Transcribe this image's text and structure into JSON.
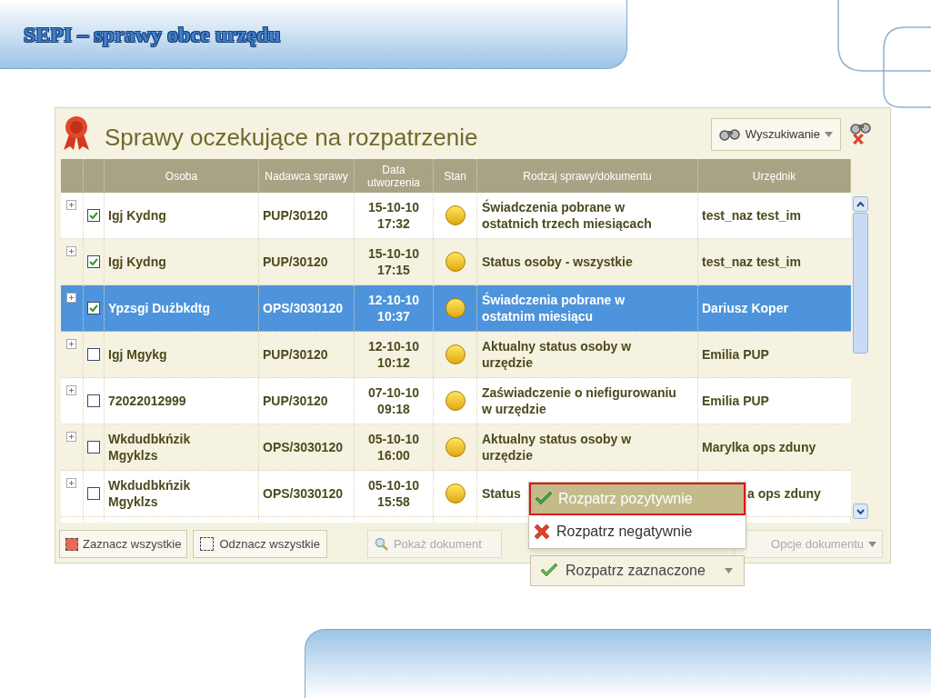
{
  "slide_title": "SEPI – sprawy obce urzędu",
  "panel": {
    "title": "Sprawy oczekujące na rozpatrzenie",
    "search_button": "Wyszukiwanie"
  },
  "table": {
    "columns": [
      "Osoba",
      "Nadawca sprawy",
      "Data utworzenia",
      "Stan",
      "Rodzaj sprawy/dokumentu",
      "Urzędnik"
    ],
    "rows": [
      {
        "checked": true,
        "selected": false,
        "osoba": "Igj Kydng",
        "nadawca": "PUP/30120",
        "date": "15-10-10",
        "time": "17:32",
        "rodzaj": "Świadczenia pobrane w ostatnich trzech miesiącach",
        "urzednik": "test_naz test_im"
      },
      {
        "checked": true,
        "selected": false,
        "osoba": "Igj Kydng",
        "nadawca": "PUP/30120",
        "date": "15-10-10",
        "time": "17:15",
        "rodzaj": "Status osoby - wszystkie",
        "urzednik": "test_naz test_im"
      },
      {
        "checked": true,
        "selected": true,
        "osoba": "Ypzsgi Dużbkdtg",
        "nadawca": "OPS/3030120",
        "date": "12-10-10",
        "time": "10:37",
        "rodzaj": "Świadczenia pobrane w ostatnim miesiącu",
        "urzednik": "Dariusz Koper"
      },
      {
        "checked": false,
        "selected": false,
        "osoba": "Igj Mgykg",
        "nadawca": "PUP/30120",
        "date": "12-10-10",
        "time": "10:12",
        "rodzaj": "Aktualny status osoby w urzędzie",
        "urzednik": "Emilia PUP"
      },
      {
        "checked": false,
        "selected": false,
        "osoba": "72022012999",
        "nadawca": "PUP/30120",
        "date": "07-10-10",
        "time": "09:18",
        "rodzaj": "Zaświadczenie o niefigurowaniu w urzędzie",
        "urzednik": "Emilia PUP"
      },
      {
        "checked": false,
        "selected": false,
        "osoba": "Wkdudbkńzik Mgyklzs",
        "nadawca": "OPS/3030120",
        "date": "05-10-10",
        "time": "16:00",
        "rodzaj": "Aktualny status osoby w urzędzie",
        "urzednik": "Marylka ops zduny"
      },
      {
        "checked": false,
        "selected": false,
        "osoba": "Wkdudbkńzik Mgyklzs",
        "nadawca": "OPS/3030120",
        "date": "05-10-10",
        "time": "15:58",
        "rodzaj": "Status",
        "urzednik": "a ops zduny"
      }
    ]
  },
  "toolbar": {
    "select_all": "Zaznacz wszystkie",
    "deselect_all": "Odznacz wszystkie",
    "show_document": "Pokaż dokument",
    "document_options": "Opcje dokumentu"
  },
  "menu": {
    "items": [
      {
        "kind": "positive",
        "label": "Rozpatrz pozytywnie",
        "selected": true
      },
      {
        "kind": "negative",
        "label": "Rozpatrz negatywnie",
        "selected": false
      }
    ],
    "button": "Rozpatrz zaznaczone"
  }
}
